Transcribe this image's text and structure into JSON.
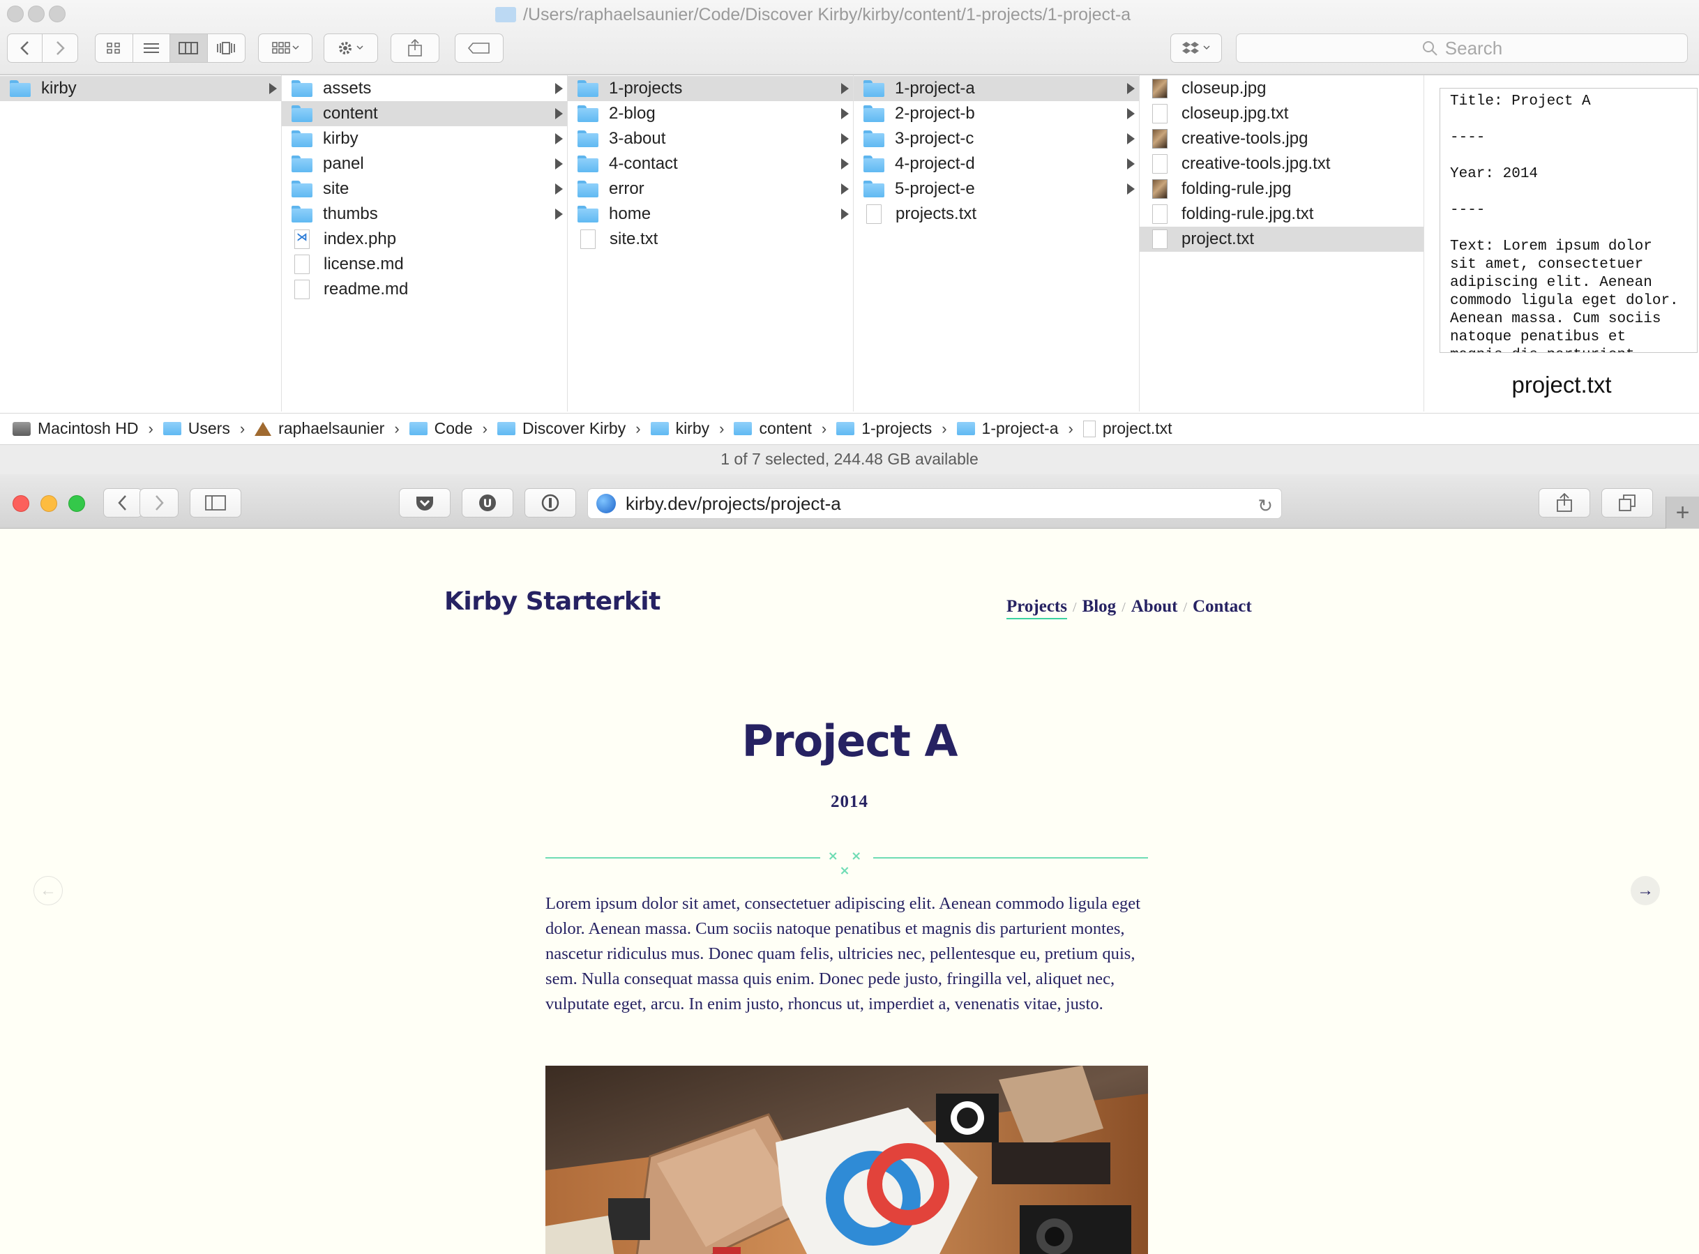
{
  "finder": {
    "path_title": "/Users/raphaelsaunier/Code/Discover Kirby/kirby/content/1-projects/1-project-a",
    "search_placeholder": "Search",
    "columns": [
      {
        "items": [
          {
            "label": "kirby",
            "kind": "folder",
            "arrow": true,
            "selected": true
          }
        ]
      },
      {
        "items": [
          {
            "label": "assets",
            "kind": "folder",
            "arrow": true
          },
          {
            "label": "content",
            "kind": "folder",
            "arrow": true,
            "selected": true
          },
          {
            "label": "kirby",
            "kind": "folder",
            "arrow": true
          },
          {
            "label": "panel",
            "kind": "folder",
            "arrow": true
          },
          {
            "label": "site",
            "kind": "folder",
            "arrow": true
          },
          {
            "label": "thumbs",
            "kind": "folder",
            "arrow": true
          },
          {
            "label": "index.php",
            "kind": "php"
          },
          {
            "label": "license.md",
            "kind": "file"
          },
          {
            "label": "readme.md",
            "kind": "file"
          }
        ]
      },
      {
        "items": [
          {
            "label": "1-projects",
            "kind": "folder",
            "arrow": true,
            "selected": true
          },
          {
            "label": "2-blog",
            "kind": "folder",
            "arrow": true
          },
          {
            "label": "3-about",
            "kind": "folder",
            "arrow": true
          },
          {
            "label": "4-contact",
            "kind": "folder",
            "arrow": true
          },
          {
            "label": "error",
            "kind": "folder",
            "arrow": true
          },
          {
            "label": "home",
            "kind": "folder",
            "arrow": true
          },
          {
            "label": "site.txt",
            "kind": "file"
          }
        ]
      },
      {
        "items": [
          {
            "label": "1-project-a",
            "kind": "folder",
            "arrow": true,
            "selected": true
          },
          {
            "label": "2-project-b",
            "kind": "folder",
            "arrow": true
          },
          {
            "label": "3-project-c",
            "kind": "folder",
            "arrow": true
          },
          {
            "label": "4-project-d",
            "kind": "folder",
            "arrow": true
          },
          {
            "label": "5-project-e",
            "kind": "folder",
            "arrow": true
          },
          {
            "label": "projects.txt",
            "kind": "file"
          }
        ]
      },
      {
        "items": [
          {
            "label": "closeup.jpg",
            "kind": "image"
          },
          {
            "label": "closeup.jpg.txt",
            "kind": "file"
          },
          {
            "label": "creative-tools.jpg",
            "kind": "image"
          },
          {
            "label": "creative-tools.jpg.txt",
            "kind": "file"
          },
          {
            "label": "folding-rule.jpg",
            "kind": "image"
          },
          {
            "label": "folding-rule.jpg.txt",
            "kind": "file"
          },
          {
            "label": "project.txt",
            "kind": "file",
            "selected": true
          }
        ]
      }
    ],
    "preview": {
      "content": "Title: Project A\n\n----\n\nYear: 2014\n\n----\n\nText: Lorem ipsum dolor sit amet, consectetuer adipiscing elit. Aenean commodo ligula eget dolor. Aenean massa. Cum sociis natoque penatibus et magnis dis parturient",
      "filename": "project.txt"
    },
    "pathbar": [
      {
        "label": "Macintosh HD",
        "icon": "hard-drive-icon"
      },
      {
        "label": "Users",
        "icon": "folder-icon"
      },
      {
        "label": "raphaelsaunier",
        "icon": "home-icon"
      },
      {
        "label": "Code",
        "icon": "folder-icon"
      },
      {
        "label": "Discover Kirby",
        "icon": "folder-icon"
      },
      {
        "label": "kirby",
        "icon": "folder-icon"
      },
      {
        "label": "content",
        "icon": "folder-icon"
      },
      {
        "label": "1-projects",
        "icon": "folder-icon"
      },
      {
        "label": "1-project-a",
        "icon": "folder-icon"
      },
      {
        "label": "project.txt",
        "icon": "file-icon"
      }
    ],
    "status": "1 of 7 selected, 244.48 GB available"
  },
  "safari": {
    "url": "kirby.dev/projects/project-a"
  },
  "site": {
    "title": "Kirby Starterkit",
    "nav": [
      "Projects",
      "Blog",
      "About",
      "Contact"
    ],
    "nav_active": "Projects",
    "page_title": "Project A",
    "year": "2014",
    "body": "Lorem ipsum dolor sit amet, consectetuer adipiscing elit. Aenean commodo ligula eget dolor. Aenean massa. Cum sociis natoque penatibus et magnis dis parturient montes, nascetur ridiculus mus. Donec quam felis, ultricies nec, pellentesque eu, pretium quis, sem. Nulla consequat massa quis enim. Donec pede justo, fringilla vel, aliquet nec, vulputate eget, arcu. In enim justo, rhoncus ut, imperdiet a, venenatis vitae, justo.",
    "divider_marks": "× × ×",
    "prev_arrow": "←",
    "next_arrow": "→"
  },
  "colors": {
    "brand_navy": "#262262",
    "accent_green": "#6fdcb4",
    "page_bg": "#fffff6",
    "folder_blue": "#60b9f2",
    "selection_grey": "#dcdcdc"
  }
}
